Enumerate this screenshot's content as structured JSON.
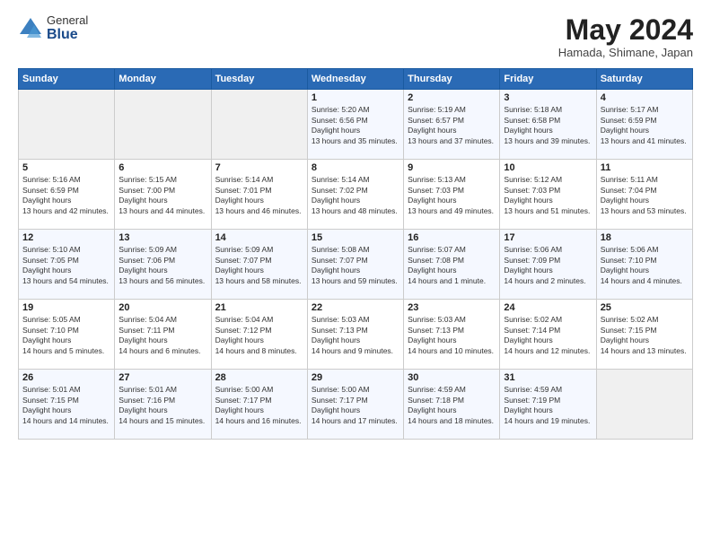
{
  "logo": {
    "general": "General",
    "blue": "Blue"
  },
  "title": "May 2024",
  "location": "Hamada, Shimane, Japan",
  "weekdays": [
    "Sunday",
    "Monday",
    "Tuesday",
    "Wednesday",
    "Thursday",
    "Friday",
    "Saturday"
  ],
  "weeks": [
    [
      {
        "day": "",
        "empty": true
      },
      {
        "day": "",
        "empty": true
      },
      {
        "day": "",
        "empty": true
      },
      {
        "day": "1",
        "rise": "5:20 AM",
        "set": "6:56 PM",
        "daylight": "13 hours and 35 minutes."
      },
      {
        "day": "2",
        "rise": "5:19 AM",
        "set": "6:57 PM",
        "daylight": "13 hours and 37 minutes."
      },
      {
        "day": "3",
        "rise": "5:18 AM",
        "set": "6:58 PM",
        "daylight": "13 hours and 39 minutes."
      },
      {
        "day": "4",
        "rise": "5:17 AM",
        "set": "6:59 PM",
        "daylight": "13 hours and 41 minutes."
      }
    ],
    [
      {
        "day": "5",
        "rise": "5:16 AM",
        "set": "6:59 PM",
        "daylight": "13 hours and 42 minutes."
      },
      {
        "day": "6",
        "rise": "5:15 AM",
        "set": "7:00 PM",
        "daylight": "13 hours and 44 minutes."
      },
      {
        "day": "7",
        "rise": "5:14 AM",
        "set": "7:01 PM",
        "daylight": "13 hours and 46 minutes."
      },
      {
        "day": "8",
        "rise": "5:14 AM",
        "set": "7:02 PM",
        "daylight": "13 hours and 48 minutes."
      },
      {
        "day": "9",
        "rise": "5:13 AM",
        "set": "7:03 PM",
        "daylight": "13 hours and 49 minutes."
      },
      {
        "day": "10",
        "rise": "5:12 AM",
        "set": "7:03 PM",
        "daylight": "13 hours and 51 minutes."
      },
      {
        "day": "11",
        "rise": "5:11 AM",
        "set": "7:04 PM",
        "daylight": "13 hours and 53 minutes."
      }
    ],
    [
      {
        "day": "12",
        "rise": "5:10 AM",
        "set": "7:05 PM",
        "daylight": "13 hours and 54 minutes."
      },
      {
        "day": "13",
        "rise": "5:09 AM",
        "set": "7:06 PM",
        "daylight": "13 hours and 56 minutes."
      },
      {
        "day": "14",
        "rise": "5:09 AM",
        "set": "7:07 PM",
        "daylight": "13 hours and 58 minutes."
      },
      {
        "day": "15",
        "rise": "5:08 AM",
        "set": "7:07 PM",
        "daylight": "13 hours and 59 minutes."
      },
      {
        "day": "16",
        "rise": "5:07 AM",
        "set": "7:08 PM",
        "daylight": "14 hours and 1 minute."
      },
      {
        "day": "17",
        "rise": "5:06 AM",
        "set": "7:09 PM",
        "daylight": "14 hours and 2 minutes."
      },
      {
        "day": "18",
        "rise": "5:06 AM",
        "set": "7:10 PM",
        "daylight": "14 hours and 4 minutes."
      }
    ],
    [
      {
        "day": "19",
        "rise": "5:05 AM",
        "set": "7:10 PM",
        "daylight": "14 hours and 5 minutes."
      },
      {
        "day": "20",
        "rise": "5:04 AM",
        "set": "7:11 PM",
        "daylight": "14 hours and 6 minutes."
      },
      {
        "day": "21",
        "rise": "5:04 AM",
        "set": "7:12 PM",
        "daylight": "14 hours and 8 minutes."
      },
      {
        "day": "22",
        "rise": "5:03 AM",
        "set": "7:13 PM",
        "daylight": "14 hours and 9 minutes."
      },
      {
        "day": "23",
        "rise": "5:03 AM",
        "set": "7:13 PM",
        "daylight": "14 hours and 10 minutes."
      },
      {
        "day": "24",
        "rise": "5:02 AM",
        "set": "7:14 PM",
        "daylight": "14 hours and 12 minutes."
      },
      {
        "day": "25",
        "rise": "5:02 AM",
        "set": "7:15 PM",
        "daylight": "14 hours and 13 minutes."
      }
    ],
    [
      {
        "day": "26",
        "rise": "5:01 AM",
        "set": "7:15 PM",
        "daylight": "14 hours and 14 minutes."
      },
      {
        "day": "27",
        "rise": "5:01 AM",
        "set": "7:16 PM",
        "daylight": "14 hours and 15 minutes."
      },
      {
        "day": "28",
        "rise": "5:00 AM",
        "set": "7:17 PM",
        "daylight": "14 hours and 16 minutes."
      },
      {
        "day": "29",
        "rise": "5:00 AM",
        "set": "7:17 PM",
        "daylight": "14 hours and 17 minutes."
      },
      {
        "day": "30",
        "rise": "4:59 AM",
        "set": "7:18 PM",
        "daylight": "14 hours and 18 minutes."
      },
      {
        "day": "31",
        "rise": "4:59 AM",
        "set": "7:19 PM",
        "daylight": "14 hours and 19 minutes."
      },
      {
        "day": "",
        "empty": true
      }
    ]
  ]
}
